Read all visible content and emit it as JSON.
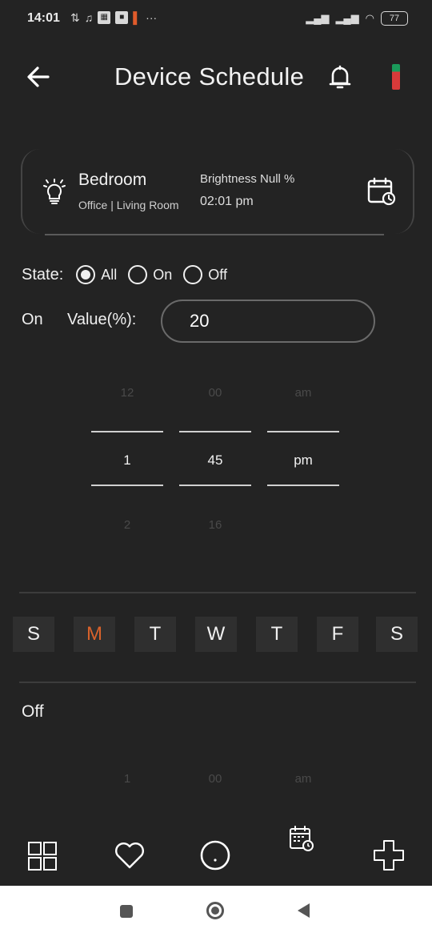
{
  "status_bar": {
    "time": "14:01",
    "left_icons": [
      "2x",
      "headphones",
      "sim",
      "notification",
      "F",
      "more"
    ],
    "battery": "77"
  },
  "header": {
    "title": "Device Schedule",
    "back_icon": "arrow-left-icon",
    "bell_icon": "bell-icon"
  },
  "device": {
    "name": "Bedroom",
    "location": "Office | Living Room",
    "brightness": "Brightness Null %",
    "time": "02:01 pm"
  },
  "state": {
    "label": "State:",
    "options": [
      "All",
      "On",
      "Off"
    ],
    "selected": "All"
  },
  "on_section": {
    "label": "On",
    "value_label": "Value(%):",
    "value": "20"
  },
  "on_picker": {
    "above": [
      "12",
      "00",
      "am"
    ],
    "selected": [
      "1",
      "45",
      "pm"
    ],
    "below": [
      "2",
      "16",
      ""
    ]
  },
  "days": {
    "labels": [
      "S",
      "M",
      "T",
      "W",
      "T",
      "F",
      "S"
    ],
    "active_index": 1
  },
  "off_section": {
    "label": "Off"
  },
  "off_picker": {
    "visible": [
      "1",
      "00",
      "am"
    ]
  },
  "colors": {
    "background": "#232323",
    "accent_day": "#d9622b",
    "marker_top": "#1a9a5a",
    "marker_bottom": "#d83a3a"
  }
}
